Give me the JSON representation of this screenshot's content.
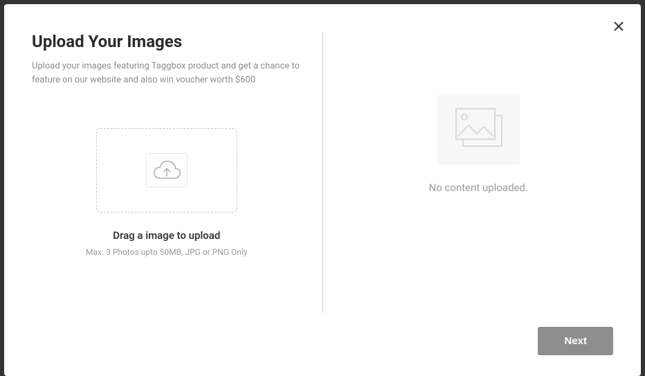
{
  "header": {
    "title": "Upload Your Images",
    "subtitle": "Upload your images featuring Taggbox product and get a chance to feature on our website and also win voucher worth $600"
  },
  "dropzone": {
    "drag_label": "Drag a image to upload",
    "limits_label": "Max. 3 Photos upto 50MB, JPG or PNG Only"
  },
  "preview": {
    "empty_label": "No content uploaded."
  },
  "footer": {
    "next_label": "Next"
  }
}
